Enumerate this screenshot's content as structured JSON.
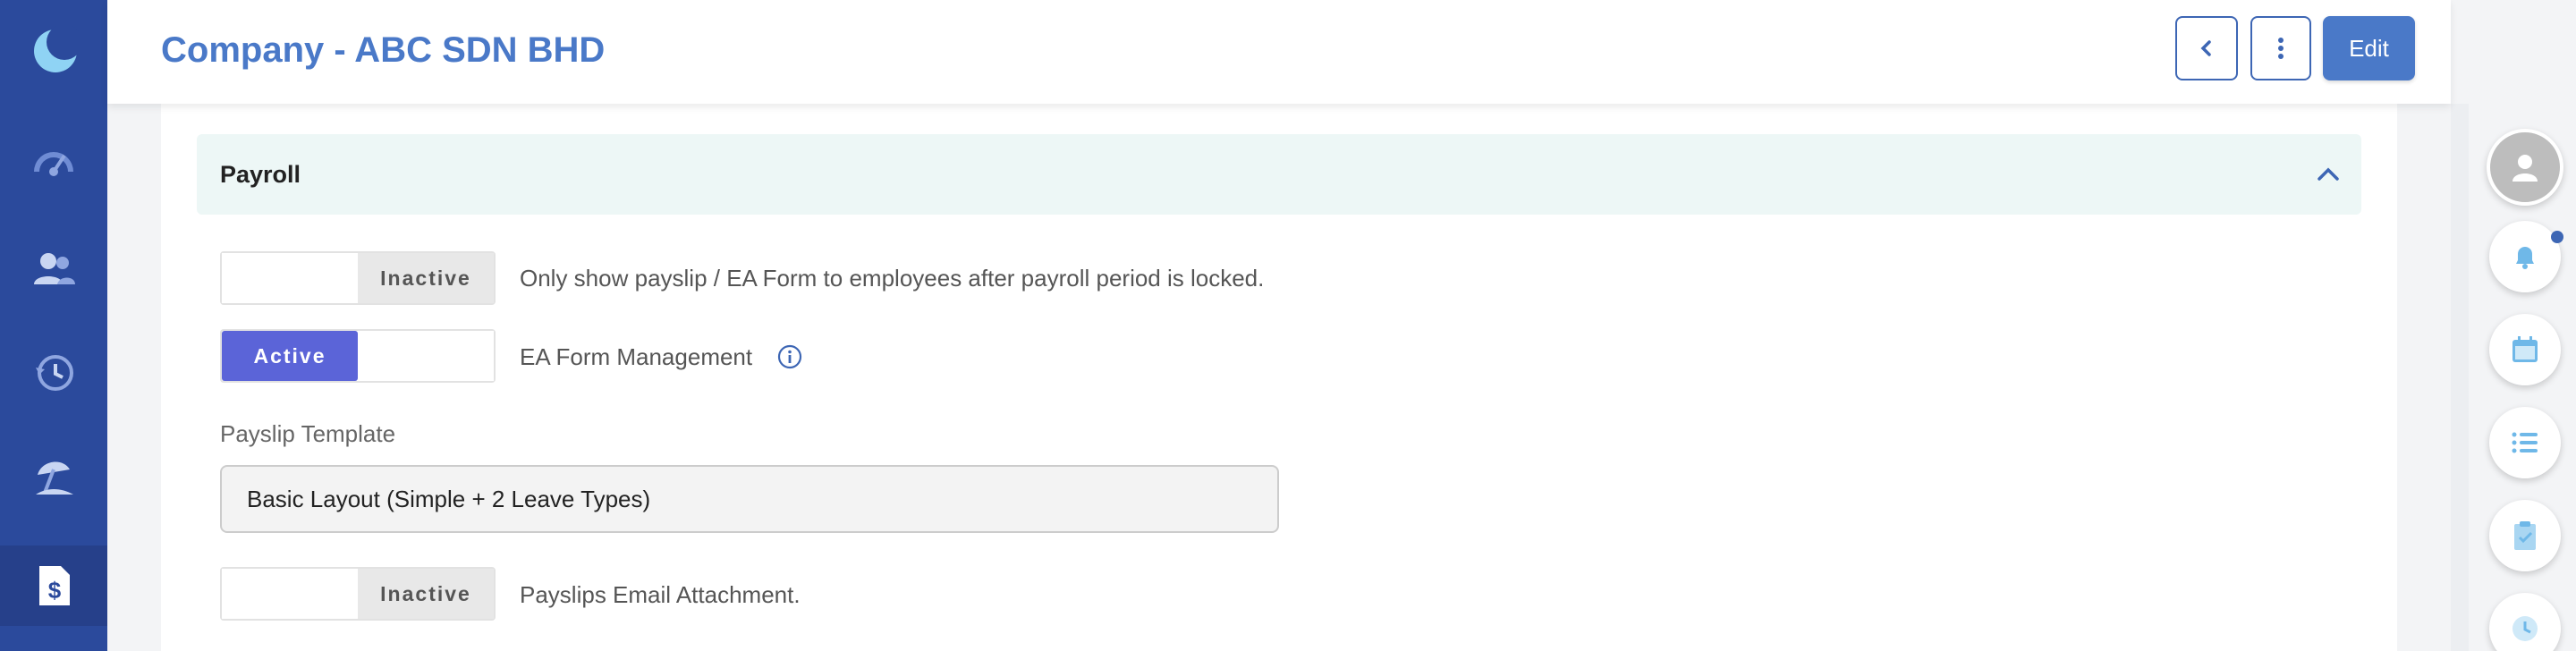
{
  "app": {
    "logo_icon": "crescent-moon-logo"
  },
  "sidebar": {
    "items": [
      {
        "icon": "dashboard-gauge-icon"
      },
      {
        "icon": "users-icon"
      },
      {
        "icon": "history-clock-icon"
      },
      {
        "icon": "leave-beach-icon"
      },
      {
        "icon": "payroll-dollar-icon",
        "active": true
      }
    ]
  },
  "header": {
    "title": "Company - ABC SDN BHD",
    "edit_label": "Edit"
  },
  "section": {
    "title": "Payroll",
    "expanded": true
  },
  "settings": [
    {
      "state_label": "Inactive",
      "active": false,
      "description": "Only show payslip / EA Form to employees after payroll period is locked."
    },
    {
      "state_label": "Active",
      "active": true,
      "description": "EA Form Management"
    },
    {
      "state_label": "Inactive",
      "active": false,
      "description": "Payslips Email Attachment."
    }
  ],
  "payslip_template": {
    "label": "Payslip Template",
    "value": "Basic Layout (Simple + 2 Leave Types)"
  },
  "colors": {
    "sidebar_bg": "#2b4a9c",
    "accent": "#4a79c8",
    "toggle_active": "#5b64d8",
    "accordion_bg": "#edf7f6",
    "rail_icon": "#6fb8e8"
  }
}
